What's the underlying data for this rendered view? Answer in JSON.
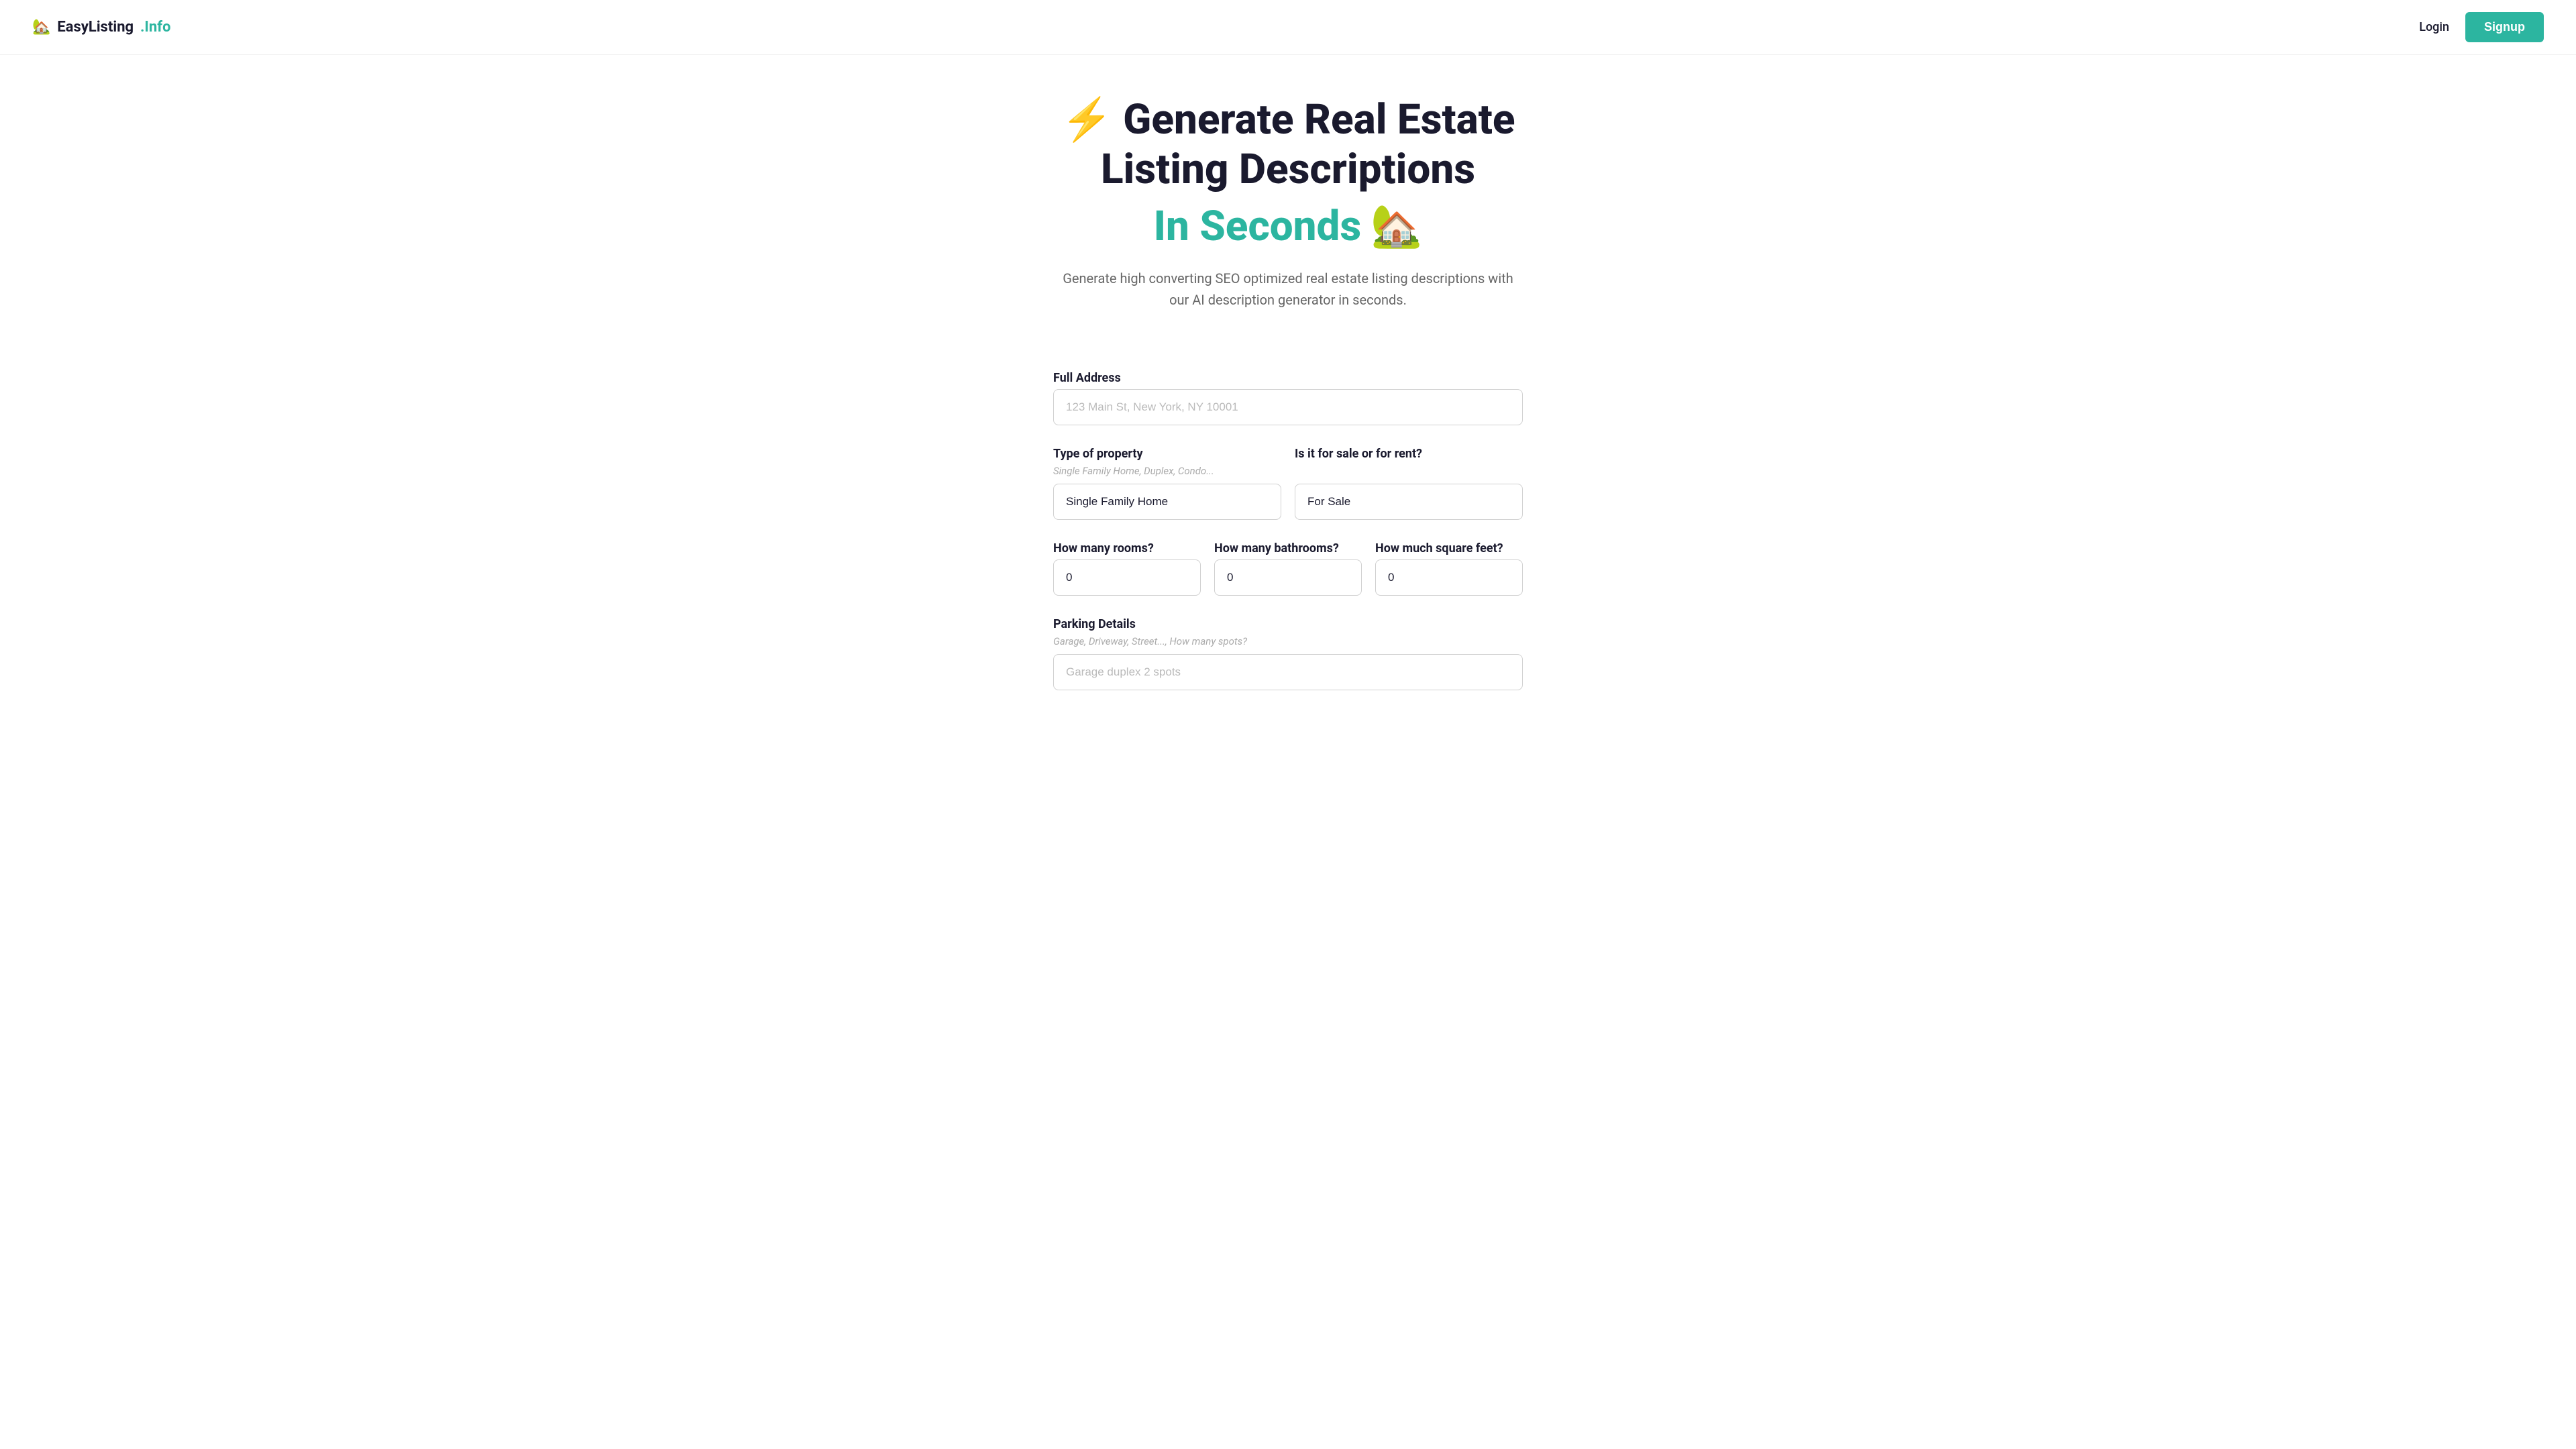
{
  "navbar": {
    "logo_emoji": "🏡",
    "logo_text_main": "EasyListing",
    "logo_text_dot": ".Info",
    "login_label": "Login",
    "signup_label": "Signup"
  },
  "hero": {
    "lightning_emoji": "⚡",
    "title_line1": "Generate Real Estate",
    "title_line2": "Listing Descriptions",
    "subtitle_text": "In Seconds",
    "house_emoji": "🏡",
    "description": "Generate high converting SEO optimized real estate listing descriptions with our AI description generator in seconds."
  },
  "form": {
    "address": {
      "label": "Full Address",
      "placeholder": "123 Main St, New York, NY 10001",
      "value": ""
    },
    "property_type": {
      "label": "Type of property",
      "hint": "Single Family Home, Duplex, Condo...",
      "placeholder": "",
      "value": "Single Family Home"
    },
    "sale_rent": {
      "label": "Is it for sale or for rent?",
      "placeholder": "",
      "value": "For Sale"
    },
    "rooms": {
      "label": "How many rooms?",
      "placeholder": "",
      "value": "0"
    },
    "bathrooms": {
      "label": "How many bathrooms?",
      "placeholder": "",
      "value": "0"
    },
    "square_feet": {
      "label": "How much square feet?",
      "placeholder": "",
      "value": "0"
    },
    "parking": {
      "label": "Parking Details",
      "hint": "Garage, Driveway, Street..., How many spots?",
      "placeholder": "Garage duplex 2 spots",
      "value": ""
    }
  },
  "colors": {
    "teal": "#2cb5a0",
    "dark": "#1a1a2e",
    "gray": "#666666"
  }
}
